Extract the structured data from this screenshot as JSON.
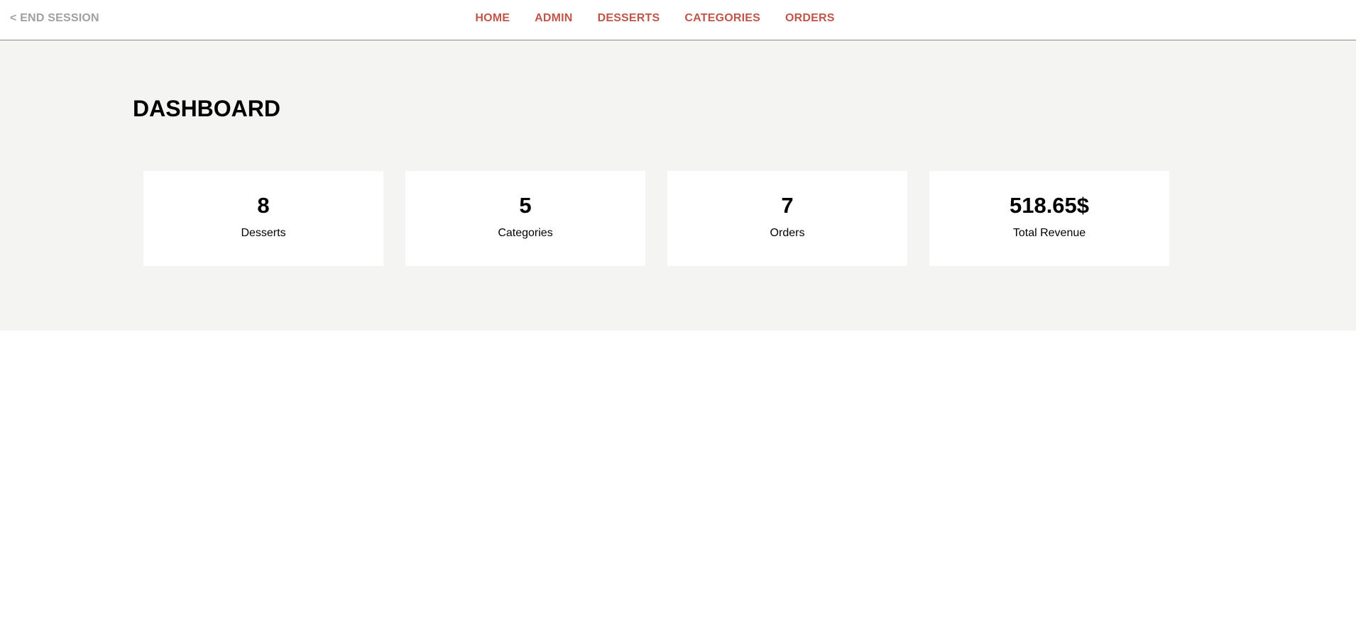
{
  "header": {
    "end_session_label": "< END SESSION",
    "nav": [
      "HOME",
      "ADMIN",
      "DESSERTS",
      "CATEGORIES",
      "ORDERS"
    ]
  },
  "main": {
    "title": "DASHBOARD",
    "stats": [
      {
        "value": "8",
        "label": "Desserts"
      },
      {
        "value": "5",
        "label": "Categories"
      },
      {
        "value": "7",
        "label": "Orders"
      },
      {
        "value": "518.65$",
        "label": "Total Revenue"
      }
    ]
  },
  "colors": {
    "nav_accent": "#c0564a",
    "muted_link": "#a0a0a0",
    "panel_background": "#f4f4f2"
  }
}
